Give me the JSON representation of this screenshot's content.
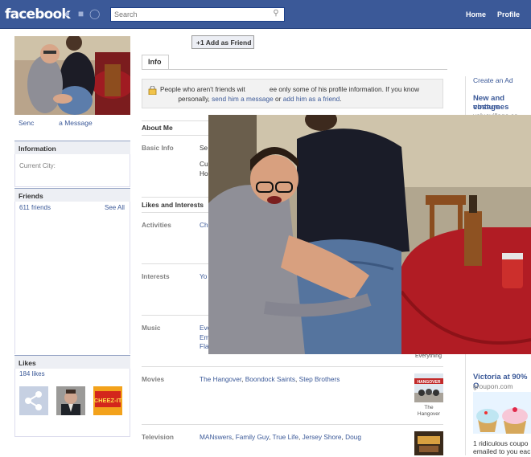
{
  "topbar": {
    "logo": "facebook",
    "search_placeholder": "Search",
    "nav": [
      "Home",
      "Profile"
    ]
  },
  "left": {
    "send_message_start": "Senc",
    "send_message_end": "a Message",
    "information_title": "Information",
    "current_city_label": "Current City:",
    "friends_title": "Friends",
    "friends_count": "611 friends",
    "see_all": "See All",
    "likes_title": "Likes",
    "likes_count": "184 likes",
    "like_thumbs": [
      "share-icon",
      "man-in-suit-photo",
      "cheez-it-logo"
    ],
    "cheez_it_text": "CHEEZ-IT"
  },
  "main": {
    "add_friend": "Add as Friend",
    "tab_info": "Info",
    "notice": {
      "part1": "People who aren't friends wit",
      "part2": "ee only some of his profile information. If you know",
      "part3": "personally,",
      "send_link": "send him a message",
      "or": "or",
      "add_link": "add him as a friend",
      "end": "."
    },
    "about_me": "About Me",
    "basic_info": {
      "label": "Basic Info",
      "frag1": "Se",
      "frag2": "Cu",
      "frag3": "Ho"
    },
    "likes_interests": "Likes and Interests",
    "activities": {
      "label": "Activities",
      "frag": "Ch"
    },
    "interests": {
      "label": "Interests",
      "frag": "Yo"
    },
    "music": {
      "label": "Music",
      "frag1": "Eve",
      "frag2": "Em",
      "frag3": "Fla",
      "thumb_caption": "Everything"
    },
    "movies": {
      "label": "Movies",
      "items": [
        "The Hangover",
        "Boondock Saints",
        "Step Brothers"
      ],
      "thumb_caption": "The Hangover",
      "poster_text": "HANGOVER"
    },
    "television": {
      "label": "Television",
      "items": [
        "MANswers",
        "Family Guy",
        "True Life",
        "Jersey Shore",
        "Doug"
      ]
    }
  },
  "right": {
    "create_ad": "Create an Ad",
    "ad1_title_1": "New and vintage",
    "ad1_title_2": "costumes",
    "ad1_url": "valuevillage.ca",
    "ad2_title": "Victoria at 90% O",
    "ad2_url": "groupon.com",
    "ad2_text_1": "1 ridiculous coupo",
    "ad2_text_2": "emailed to you eac"
  }
}
